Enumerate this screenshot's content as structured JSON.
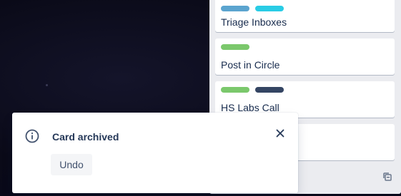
{
  "list": {
    "cards": [
      {
        "title": "Triage Inboxes",
        "labels": [
          {
            "color": "#5ba4cf"
          },
          {
            "color": "#29cce5"
          }
        ]
      },
      {
        "title": "Post in Circle",
        "labels": [
          {
            "color": "#7bc86c"
          }
        ]
      },
      {
        "title": "HS Labs Call",
        "labels": [
          {
            "color": "#7bc86c"
          },
          {
            "color": "#344563"
          }
        ]
      },
      {
        "title": "",
        "labels": []
      }
    ]
  },
  "toast": {
    "title": "Card archived",
    "undo_label": "Undo",
    "icon": "info-icon",
    "close_icon": "close-icon"
  },
  "colors": {
    "card_text": "#172b4d",
    "list_bg": "#ebecf0",
    "board_bg": "#0b0b1a"
  }
}
